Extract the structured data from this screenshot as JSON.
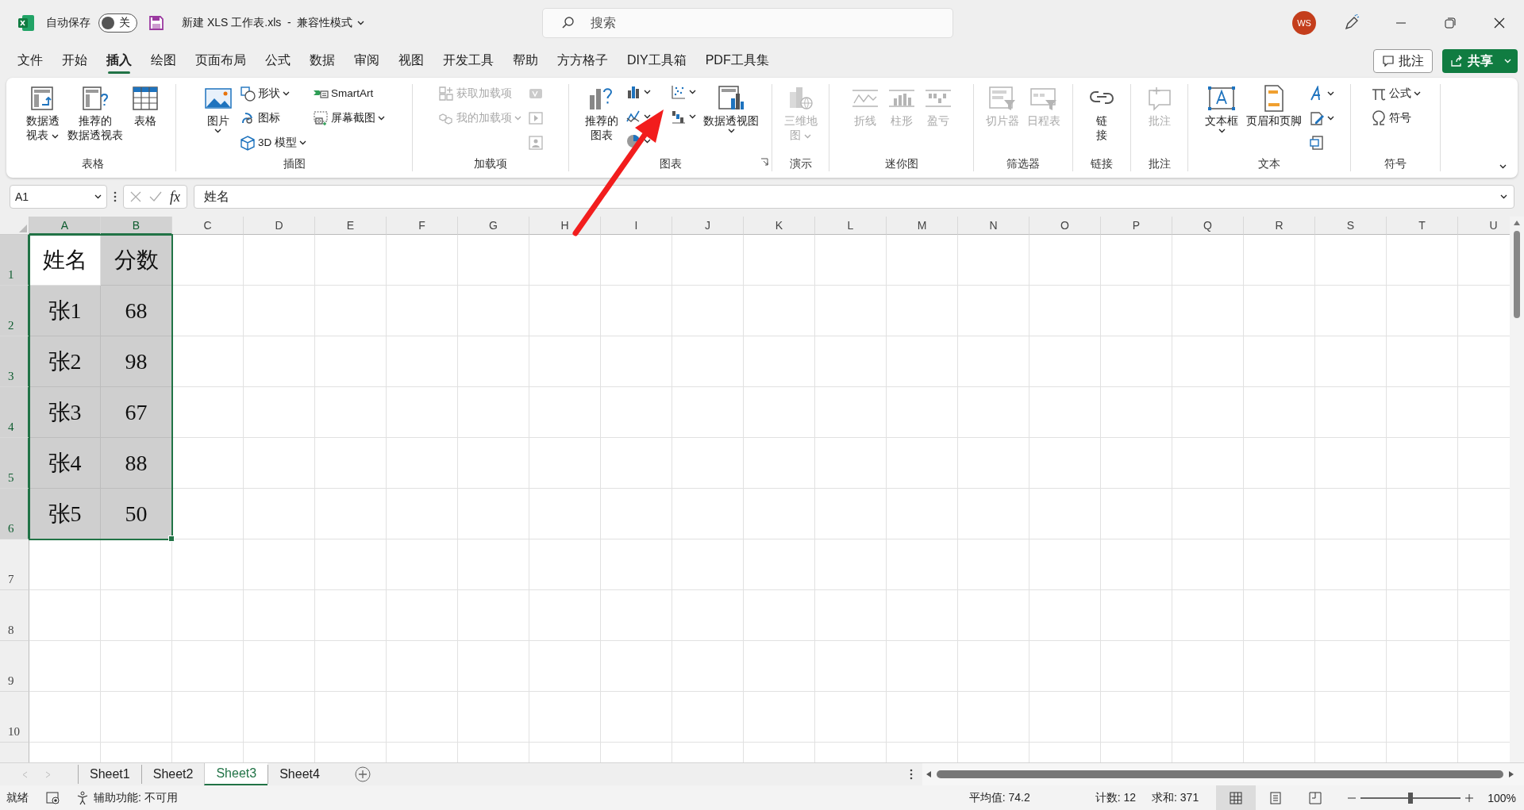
{
  "title_bar": {
    "autosave": {
      "label": "自动保存",
      "on": false,
      "state_text": "关"
    },
    "title": "新建 XLS 工作表.xls  -  兼容性模式",
    "search": {
      "placeholder": "搜索"
    },
    "user_initials": "WS"
  },
  "menu_tabs": [
    {
      "label": "文件",
      "selected": false
    },
    {
      "label": "开始",
      "selected": false
    },
    {
      "label": "插入",
      "selected": true
    },
    {
      "label": "绘图",
      "selected": false
    },
    {
      "label": "页面布局",
      "selected": false
    },
    {
      "label": "公式",
      "selected": false
    },
    {
      "label": "数据",
      "selected": false
    },
    {
      "label": "审阅",
      "selected": false
    },
    {
      "label": "视图",
      "selected": false
    },
    {
      "label": "开发工具",
      "selected": false
    },
    {
      "label": "帮助",
      "selected": false
    },
    {
      "label": "方方格子",
      "selected": false
    },
    {
      "label": "DIY工具箱",
      "selected": false
    },
    {
      "label": "PDF工具集",
      "selected": false
    }
  ],
  "comment_button": "批注",
  "share_button": "共享",
  "ribbon_groups": [
    {
      "title": "表格",
      "dialog_launcher": false,
      "items": [
        {
          "kind": "large",
          "label": "数据透视表",
          "dropdown": true,
          "disabled": false
        },
        {
          "kind": "large",
          "label": "推荐的数据透视表",
          "dropdown": false,
          "disabled": false
        },
        {
          "kind": "large",
          "label": "表格",
          "dropdown": false,
          "disabled": false
        }
      ]
    },
    {
      "title": "插图",
      "dialog_launcher": false,
      "items": [
        {
          "kind": "large",
          "label": "图片",
          "dropdown": true,
          "disabled": false
        },
        {
          "kind": "stack",
          "items": [
            {
              "label": "形状",
              "dropdown": true,
              "disabled": false
            },
            {
              "label": "图标",
              "dropdown": false,
              "disabled": false
            },
            {
              "label": "3D 模型",
              "dropdown": true,
              "disabled": false
            }
          ]
        },
        {
          "kind": "stack",
          "items": [
            {
              "label": "SmartArt",
              "dropdown": false,
              "disabled": false
            },
            {
              "label": "屏幕截图",
              "dropdown": true,
              "disabled": false
            }
          ]
        }
      ]
    },
    {
      "title": "加载项",
      "dialog_launcher": false,
      "items": [
        {
          "kind": "stack",
          "items": [
            {
              "label": "获取加载项",
              "dropdown": false,
              "disabled": true
            },
            {
              "label": "我的加载项",
              "dropdown": true,
              "disabled": true
            }
          ]
        },
        {
          "kind": "stack",
          "items": [
            {
              "dropdown": false,
              "disabled": true
            },
            {
              "dropdown": false,
              "disabled": true
            },
            {
              "dropdown": false,
              "disabled": true
            }
          ]
        }
      ]
    },
    {
      "title": "图表",
      "dialog_launcher": true,
      "items": [
        {
          "kind": "large",
          "label": "推荐的图表",
          "dropdown": false,
          "disabled": false
        },
        {
          "kind": "stack",
          "items": [
            {
              "dropdown": true,
              "disabled": false
            },
            {
              "dropdown": true,
              "disabled": false
            },
            {
              "dropdown": true,
              "disabled": false
            }
          ]
        },
        {
          "kind": "stack",
          "items": [
            {
              "dropdown": true,
              "disabled": false
            },
            {
              "dropdown": true,
              "disabled": false
            }
          ]
        },
        {
          "kind": "large",
          "label": "数据透视图",
          "dropdown": true,
          "disabled": false
        }
      ]
    },
    {
      "title": "演示",
      "dialog_launcher": false,
      "items": [
        {
          "kind": "large",
          "label": "三维地图",
          "dropdown": true,
          "disabled": true
        }
      ]
    },
    {
      "title": "迷你图",
      "dialog_launcher": false,
      "items": [
        {
          "kind": "large",
          "label": "折线",
          "dropdown": false,
          "disabled": true
        },
        {
          "kind": "large",
          "label": "柱形",
          "dropdown": false,
          "disabled": true
        },
        {
          "kind": "large",
          "label": "盈亏",
          "dropdown": false,
          "disabled": true
        }
      ]
    },
    {
      "title": "筛选器",
      "dialog_launcher": false,
      "items": [
        {
          "kind": "large",
          "label": "切片器",
          "dropdown": false,
          "disabled": true
        },
        {
          "kind": "large",
          "label": "日程表",
          "dropdown": false,
          "disabled": true
        }
      ]
    },
    {
      "title": "链接",
      "dialog_launcher": false,
      "items": [
        {
          "kind": "large",
          "label": "链接",
          "dropdown": false,
          "disabled": false
        }
      ]
    },
    {
      "title": "批注",
      "dialog_launcher": false,
      "items": [
        {
          "kind": "large",
          "label": "批注",
          "dropdown": false,
          "disabled": true
        }
      ]
    },
    {
      "title": "文本",
      "dialog_launcher": false,
      "items": [
        {
          "kind": "large",
          "label": "文本框",
          "dropdown": true,
          "disabled": false
        },
        {
          "kind": "large",
          "label": "页眉和页脚",
          "dropdown": false,
          "disabled": false
        },
        {
          "kind": "stack",
          "items": [
            {
              "dropdown": true,
              "disabled": false
            },
            {
              "dropdown": true,
              "disabled": false
            },
            {
              "dropdown": false,
              "disabled": false
            }
          ]
        }
      ]
    },
    {
      "title": "符号",
      "dialog_launcher": false,
      "items": [
        {
          "kind": "stack",
          "items": [
            {
              "label": "公式",
              "dropdown": true,
              "disabled": false
            },
            {
              "label": "符号",
              "dropdown": false,
              "disabled": false
            }
          ]
        }
      ]
    }
  ],
  "formula_bar": {
    "name_box": "A1",
    "function_label": "fx",
    "formula": "姓名"
  },
  "sheet": {
    "columns": [
      {
        "label": "A",
        "selected": true
      },
      {
        "label": "B",
        "selected": true
      },
      {
        "label": "C",
        "selected": false
      },
      {
        "label": "D",
        "selected": false
      },
      {
        "label": "E",
        "selected": false
      },
      {
        "label": "F",
        "selected": false
      },
      {
        "label": "G",
        "selected": false
      },
      {
        "label": "H",
        "selected": false
      },
      {
        "label": "I",
        "selected": false
      },
      {
        "label": "J",
        "selected": false
      },
      {
        "label": "K",
        "selected": false
      },
      {
        "label": "L",
        "selected": false
      },
      {
        "label": "M",
        "selected": false
      },
      {
        "label": "N",
        "selected": false
      },
      {
        "label": "O",
        "selected": false
      },
      {
        "label": "P",
        "selected": false
      },
      {
        "label": "Q",
        "selected": false
      },
      {
        "label": "R",
        "selected": false
      },
      {
        "label": "S",
        "selected": false
      },
      {
        "label": "T",
        "selected": false
      },
      {
        "label": "U",
        "selected": false
      }
    ],
    "rows": [
      {
        "label": "1",
        "selected": true,
        "cells": [
          {
            "text": "姓名",
            "selected": true,
            "active": true
          },
          {
            "text": "分数",
            "selected": true,
            "active": false
          }
        ]
      },
      {
        "label": "2",
        "selected": true,
        "cells": [
          {
            "text": "张1",
            "selected": true,
            "active": false
          },
          {
            "text": "68",
            "selected": true,
            "active": false
          }
        ]
      },
      {
        "label": "3",
        "selected": true,
        "cells": [
          {
            "text": "张2",
            "selected": true,
            "active": false
          },
          {
            "text": "98",
            "selected": true,
            "active": false
          }
        ]
      },
      {
        "label": "4",
        "selected": true,
        "cells": [
          {
            "text": "张3",
            "selected": true,
            "active": false
          },
          {
            "text": "67",
            "selected": true,
            "active": false
          }
        ]
      },
      {
        "label": "5",
        "selected": true,
        "cells": [
          {
            "text": "张4",
            "selected": true,
            "active": false
          },
          {
            "text": "88",
            "selected": true,
            "active": false
          }
        ]
      },
      {
        "label": "6",
        "selected": true,
        "cells": [
          {
            "text": "张5",
            "selected": true,
            "active": false
          },
          {
            "text": "50",
            "selected": true,
            "active": false
          }
        ]
      },
      {
        "label": "7",
        "selected": false
      },
      {
        "label": "8",
        "selected": false
      },
      {
        "label": "9",
        "selected": false
      },
      {
        "label": "10",
        "selected": false
      }
    ]
  },
  "sheet_tabs": [
    {
      "label": "Sheet1",
      "selected": false
    },
    {
      "label": "Sheet2",
      "selected": false
    },
    {
      "label": "Sheet3",
      "selected": true
    },
    {
      "label": "Sheet4",
      "selected": false
    }
  ],
  "status_bar": {
    "ready": "就绪",
    "accessibility": "辅助功能: 不可用",
    "average": "平均值: 74.2",
    "count": "计数: 12",
    "sum": "求和: 371",
    "view_modes": [
      {
        "selected": true
      },
      {
        "selected": false
      },
      {
        "selected": false
      }
    ],
    "zoom": {
      "level": 0.5,
      "reading": "100%"
    }
  },
  "annotations": [
    {
      "kind": "arrow"
    }
  ]
}
